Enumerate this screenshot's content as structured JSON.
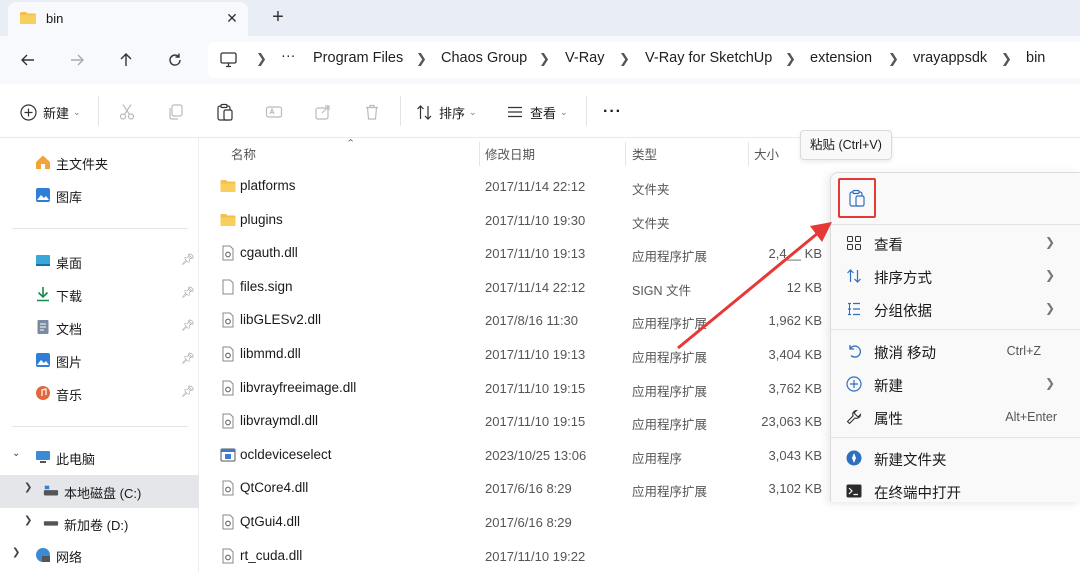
{
  "tab": {
    "title": "bin",
    "close": "✕",
    "new": "+"
  },
  "nav": {
    "more": "···",
    "breadcrumb": [
      "Program Files",
      "Chaos Group",
      "V-Ray",
      "V-Ray for SketchUp",
      "extension",
      "vrayappsdk",
      "bin"
    ]
  },
  "toolbar": {
    "new_label": "新建",
    "sort_label": "排序",
    "view_label": "查看",
    "more_label": "···"
  },
  "sidebar": {
    "items": [
      {
        "label": "主文件夹",
        "icon": "home-icon"
      },
      {
        "label": "图库",
        "icon": "gallery-icon"
      },
      {
        "label": "桌面",
        "icon": "desktop-icon",
        "pinned": true
      },
      {
        "label": "下载",
        "icon": "download-icon",
        "pinned": true
      },
      {
        "label": "文档",
        "icon": "document-icon",
        "pinned": true
      },
      {
        "label": "图片",
        "icon": "pictures-icon",
        "pinned": true
      },
      {
        "label": "音乐",
        "icon": "music-icon",
        "pinned": true
      },
      {
        "label": "此电脑",
        "icon": "pc-icon"
      },
      {
        "label": "本地磁盘 (C:)",
        "icon": "drive-icon",
        "selected": true
      },
      {
        "label": "新加卷 (D:)",
        "icon": "drive-icon"
      },
      {
        "label": "网络",
        "icon": "network-icon"
      }
    ]
  },
  "columns": {
    "name": "名称",
    "date": "修改日期",
    "type": "类型",
    "size": "大小"
  },
  "files": [
    {
      "name": "platforms",
      "date": "2017/11/14 22:12",
      "type": "文件夹",
      "size": "",
      "icon": "folder-icon"
    },
    {
      "name": "plugins",
      "date": "2017/11/10 19:30",
      "type": "文件夹",
      "size": "",
      "icon": "folder-icon"
    },
    {
      "name": "cgauth.dll",
      "date": "2017/11/10 19:13",
      "type": "应用程序扩展",
      "size": "2,4__ KB",
      "icon": "dll-icon"
    },
    {
      "name": "files.sign",
      "date": "2017/11/14 22:12",
      "type": "SIGN 文件",
      "size": "12 KB",
      "icon": "file-icon"
    },
    {
      "name": "libGLESv2.dll",
      "date": "2017/8/16 11:30",
      "type": "应用程序扩展",
      "size": "1,962 KB",
      "icon": "dll-icon"
    },
    {
      "name": "libmmd.dll",
      "date": "2017/11/10 19:13",
      "type": "应用程序扩展",
      "size": "3,404 KB",
      "icon": "dll-icon"
    },
    {
      "name": "libvrayfreeimage.dll",
      "date": "2017/11/10 19:15",
      "type": "应用程序扩展",
      "size": "3,762 KB",
      "icon": "dll-icon"
    },
    {
      "name": "libvraymdl.dll",
      "date": "2017/11/10 19:15",
      "type": "应用程序扩展",
      "size": "23,063 KB",
      "icon": "dll-icon"
    },
    {
      "name": "ocldeviceselect",
      "date": "2023/10/25 13:06",
      "type": "应用程序",
      "size": "3,043 KB",
      "icon": "app-icon"
    },
    {
      "name": "QtCore4.dll",
      "date": "2017/6/16 8:29",
      "type": "应用程序扩展",
      "size": "3,102 KB",
      "icon": "dll-icon"
    },
    {
      "name": "QtGui4.dll",
      "date": "2017/6/16 8:29",
      "type": "",
      "size": "",
      "icon": "dll-icon"
    },
    {
      "name": "rt_cuda.dll",
      "date": "2017/11/10 19:22",
      "type": "",
      "size": "",
      "icon": "dll-icon"
    }
  ],
  "tooltip": "粘贴 (Ctrl+V)",
  "context_menu": {
    "items": [
      {
        "label": "查看",
        "icon": "grid-icon",
        "submenu": true
      },
      {
        "label": "排序方式",
        "icon": "sort-icon",
        "submenu": true
      },
      {
        "label": "分组依据",
        "icon": "group-icon",
        "submenu": true
      },
      {
        "label": "撤消 移动",
        "icon": "undo-icon",
        "shortcut": "Ctrl+Z"
      },
      {
        "label": "新建",
        "icon": "plus-circle-icon",
        "submenu": true
      },
      {
        "label": "属性",
        "icon": "wrench-icon",
        "shortcut": "Alt+Enter"
      },
      {
        "label": "新建文件夹",
        "icon": "new-folder-icon"
      },
      {
        "label": "在终端中打开",
        "icon": "terminal-icon"
      }
    ]
  },
  "colors": {
    "accent": "#0067c0",
    "highlight": "#e53935",
    "folder": "#f4c04b"
  }
}
